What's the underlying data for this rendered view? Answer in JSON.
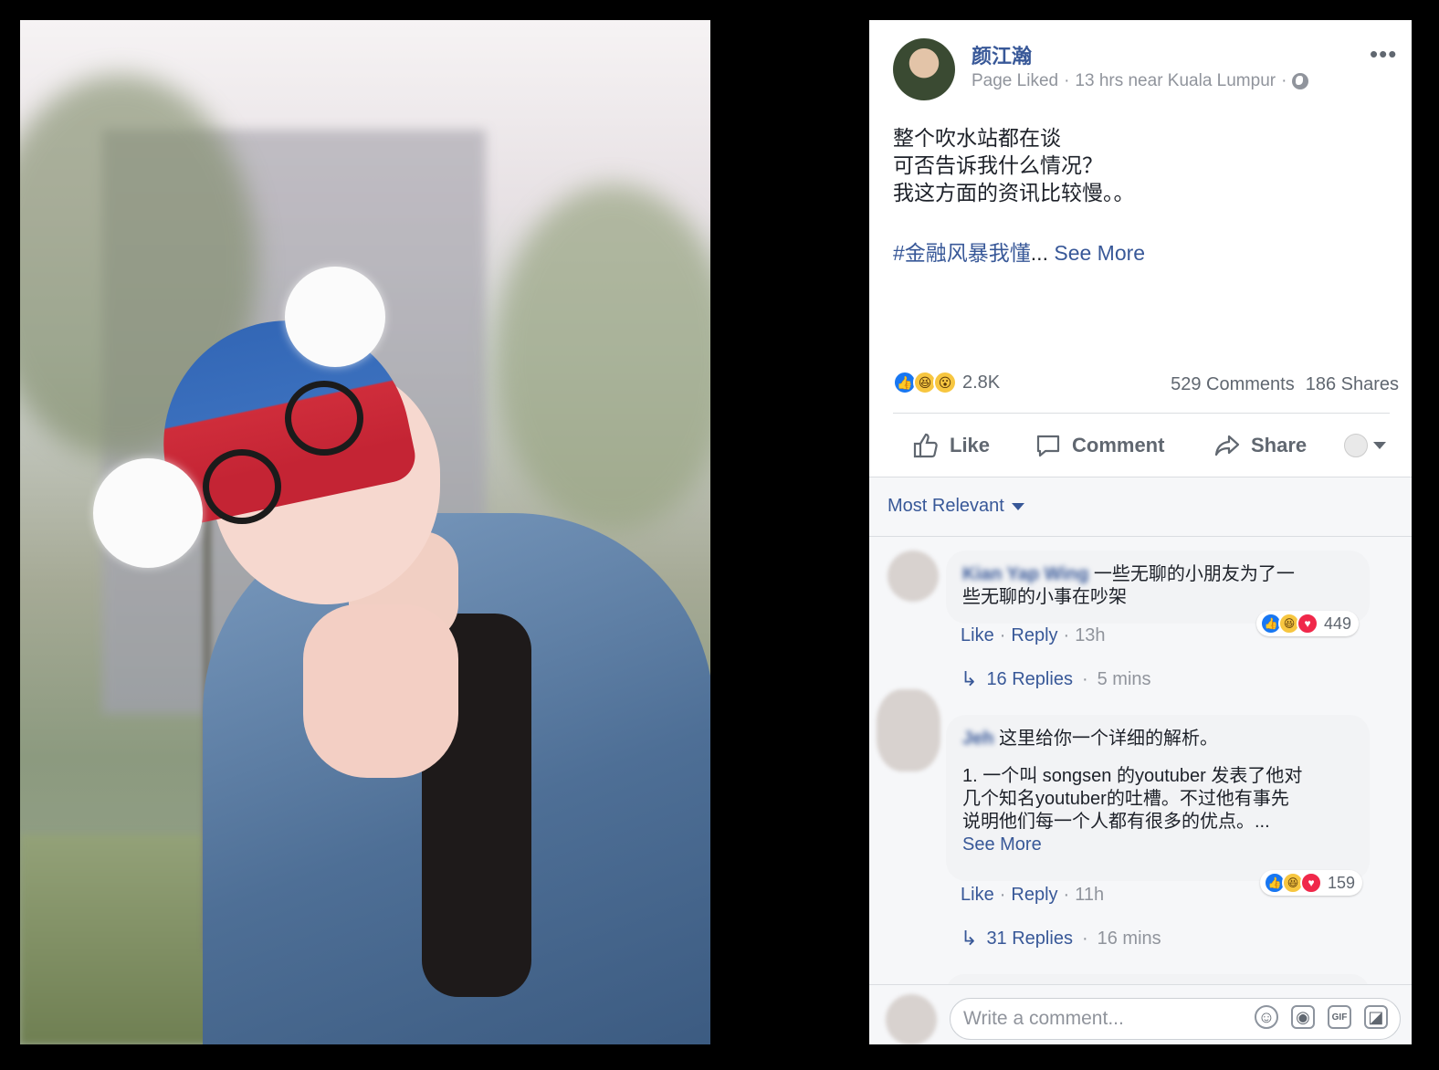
{
  "post": {
    "author": "颜江瀚",
    "meta": {
      "liked": "Page Liked",
      "time_location": "13 hrs near Kuala Lumpur",
      "separator": "·"
    },
    "text_lines": [
      "整个吹水站都在谈",
      "可否告诉我什么情况？",
      "我这方面的资讯比较慢。。"
    ],
    "hashtag": "#金融风暴我懂",
    "ellipsis": "...",
    "see_more": "See More",
    "reaction_count": "2.8K",
    "comments_count": "529 Comments",
    "shares_count": "186 Shares"
  },
  "actions": {
    "like": "Like",
    "comment": "Comment",
    "share": "Share"
  },
  "comments": {
    "sort_label": "Most Relevant",
    "items": [
      {
        "name": "Kian Yap Wing",
        "text_lines": [
          "一些无聊的小朋友为了一",
          "些无聊的小事在吵架"
        ],
        "reaction_count": "449",
        "like": "Like",
        "reply": "Reply",
        "time": "13h",
        "replies_label": "16 Replies",
        "replies_time": "5 mins"
      },
      {
        "name": "Jeh",
        "first_line": "这里给你一个详细的解析。",
        "body_lines": [
          "1. 一个叫 songsen 的youtuber 发表了他对",
          "几个知名youtuber的吐槽。不过他有事先",
          "说明他们每一个人都有很多的优点。..."
        ],
        "see_more": "See More",
        "reaction_count": "159",
        "like": "Like",
        "reply": "Reply",
        "time": "11h",
        "replies_label": "31 Replies",
        "replies_time": "16 mins"
      }
    ]
  },
  "composer": {
    "placeholder": "Write a comment...",
    "tools": [
      "emoji-icon",
      "camera-icon",
      "gif-icon",
      "sticker-icon"
    ],
    "gif_label": "GIF"
  },
  "colors": {
    "link": "#385898",
    "muted": "#90949c",
    "like_blue": "#1877f2",
    "love_red": "#f0284a",
    "haha_yellow": "#f7c640"
  }
}
